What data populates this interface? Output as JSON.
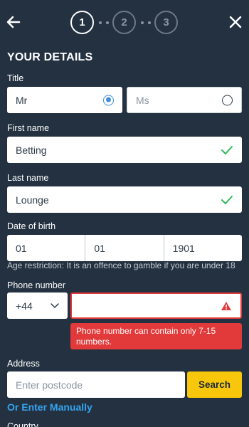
{
  "header": {
    "steps": [
      "1",
      "2",
      "3"
    ],
    "active_step": "1",
    "back_icon": "arrow-left-icon",
    "close_icon": "close-icon"
  },
  "form": {
    "heading": "YOUR DETAILS",
    "title": {
      "label": "Title",
      "options": [
        "Mr",
        "Ms"
      ],
      "selected": "Mr"
    },
    "first_name": {
      "label": "First name",
      "value": "Betting",
      "valid": true
    },
    "last_name": {
      "label": "Last name",
      "value": "Lounge",
      "valid": true
    },
    "dob": {
      "label": "Date of birth",
      "day": "01",
      "month": "01",
      "year": "1901",
      "note": "Age restriction: It is an offence to gamble if you are under 18"
    },
    "phone": {
      "label": "Phone number",
      "country_code": "+44",
      "value": "",
      "error": "Phone number can contain only 7-15 numbers."
    },
    "address": {
      "label": "Address",
      "placeholder": "Enter postcode",
      "search_label": "Search",
      "manual_link": "Or Enter Manually"
    },
    "next_label_partial": "Country"
  },
  "colors": {
    "background": "#233140",
    "accent_blue": "#36a4f0",
    "success_green": "#2fb85a",
    "error_red": "#e23a3a",
    "button_yellow": "#f8c70c"
  }
}
